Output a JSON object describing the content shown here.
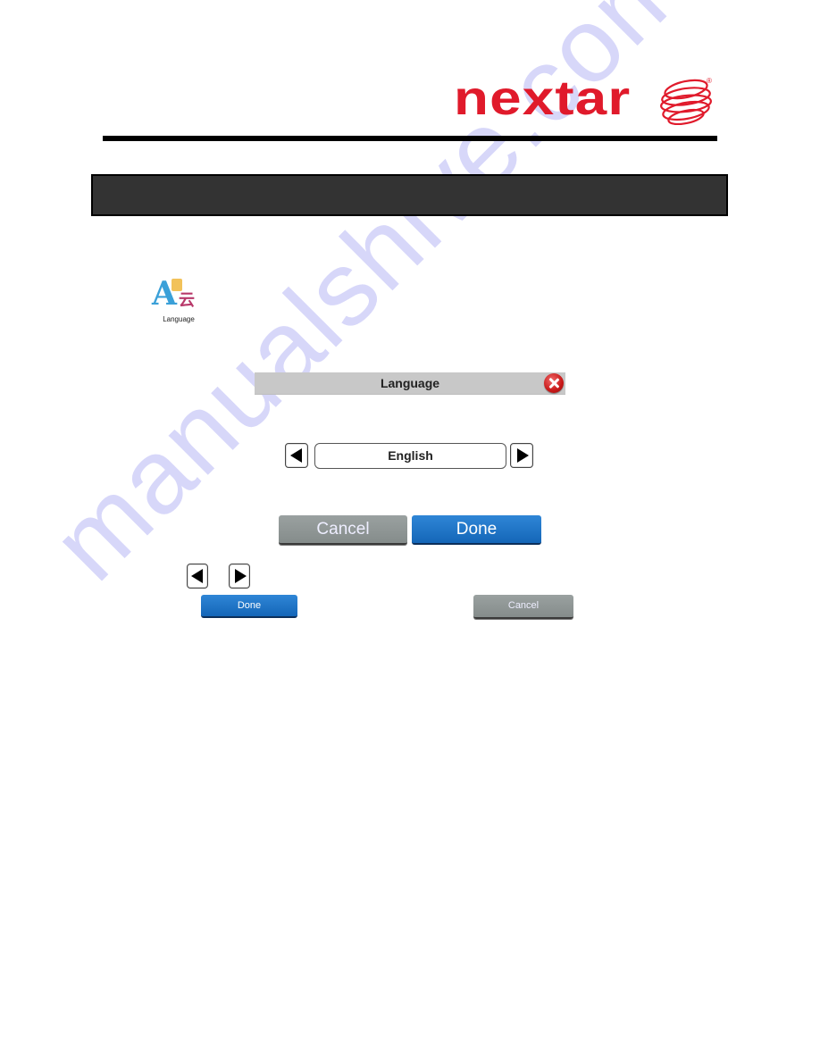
{
  "header": {
    "brand_name": "nextar",
    "registered_mark": "®",
    "brand_color": "#e01a2b"
  },
  "section_title_bar": {
    "text": "",
    "background_color": "#333333"
  },
  "app_icon": {
    "icon": "language-icon",
    "label": "Language"
  },
  "dialog": {
    "title": "Language",
    "close_icon": "close-icon",
    "selector": {
      "prev_icon": "arrow-left-icon",
      "value": "English",
      "next_icon": "arrow-right-icon"
    },
    "buttons": {
      "cancel_label": "Cancel",
      "done_label": "Done"
    }
  },
  "legend": {
    "prev_icon": "arrow-left-icon",
    "next_icon": "arrow-right-icon",
    "done_label": "Done",
    "cancel_label": "Cancel"
  },
  "watermark": {
    "text": "manualshive.com",
    "color": "#c8c8f8"
  }
}
